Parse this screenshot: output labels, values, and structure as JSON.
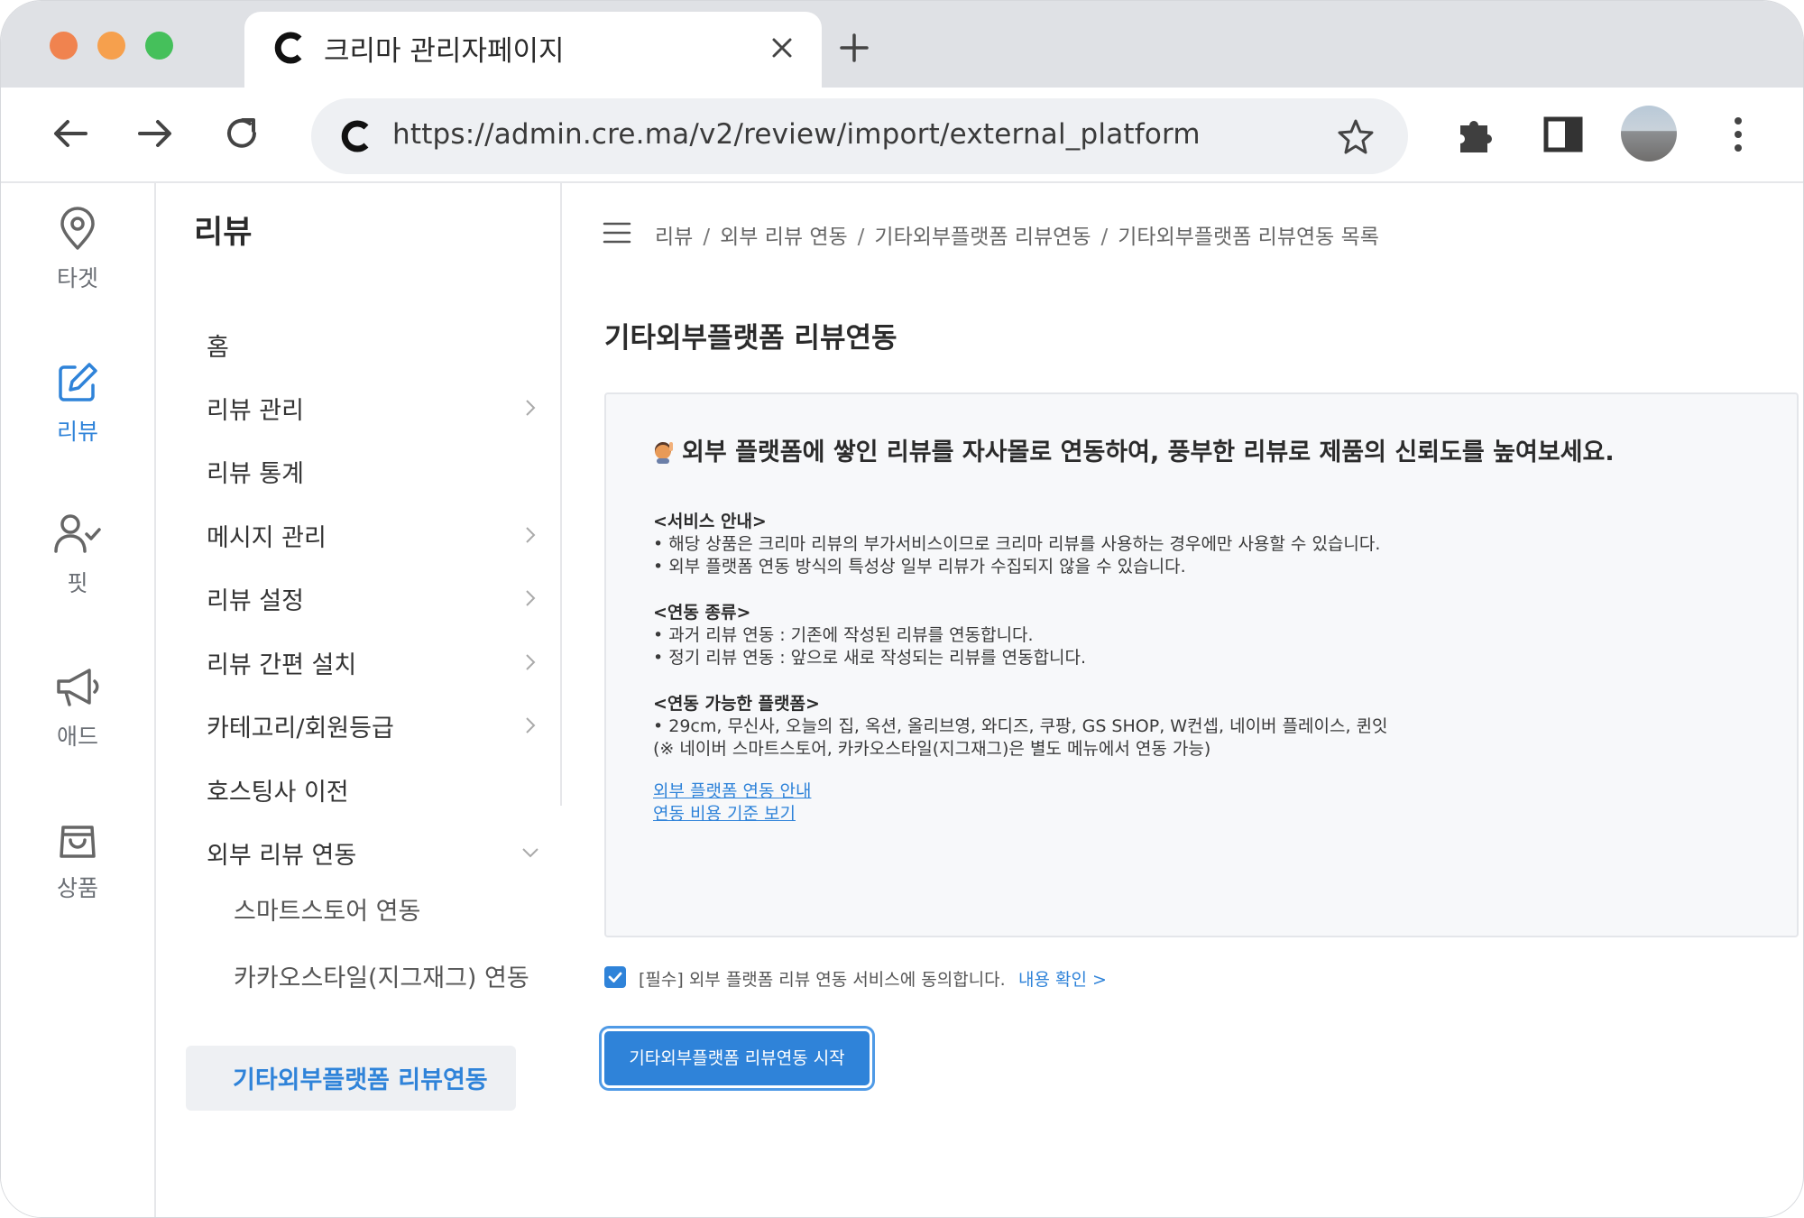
{
  "browser": {
    "tab_title": "크리마 관리자페이지",
    "url": "https://admin.cre.ma/v2/review/import/external_platform"
  },
  "rail": {
    "items": [
      {
        "label": "타겟",
        "icon": "map-pin-icon"
      },
      {
        "label": "리뷰",
        "icon": "edit-icon"
      },
      {
        "label": "핏",
        "icon": "user-check-icon"
      },
      {
        "label": "애드",
        "icon": "megaphone-icon"
      },
      {
        "label": "상품",
        "icon": "shopping-bag-icon"
      }
    ],
    "active": "리뷰"
  },
  "menu": {
    "title": "리뷰",
    "items": [
      {
        "label": "홈"
      },
      {
        "label": "리뷰 관리"
      },
      {
        "label": "리뷰 통계"
      },
      {
        "label": "메시지 관리"
      },
      {
        "label": "리뷰 설정"
      },
      {
        "label": "리뷰 간편 설치"
      },
      {
        "label": "카테고리/회원등급"
      },
      {
        "label": "호스팅사 이전"
      },
      {
        "label": "외부 리뷰 연동"
      }
    ],
    "subitems": [
      {
        "label": "스마트스토어 연동"
      },
      {
        "label": "카카오스타일(지그재그) 연동"
      },
      {
        "label": "기타외부플랫폼 리뷰연동"
      }
    ]
  },
  "breadcrumb": [
    "리뷰",
    "외부 리뷰 연동",
    "기타외부플랫폼 리뷰연동",
    "기타외부플랫폼 리뷰연동 목록"
  ],
  "page_title": "기타외부플랫폼 리뷰연동",
  "info": {
    "headline": "외부 플랫폼에 쌓인 리뷰를 자사몰로 연동하여, 풍부한 리뷰로 제품의 신뢰도를 높여보세요.",
    "service_title": "<서비스 안내>",
    "service_lines": [
      "• 해당 상품은 크리마 리뷰의 부가서비스이므로 크리마 리뷰를 사용하는 경우에만 사용할 수 있습니다.",
      "• 외부 플랫폼 연동 방식의 특성상 일부 리뷰가 수집되지 않을 수 있습니다."
    ],
    "types_title": "<연동 종류>",
    "types_lines": [
      "• 과거 리뷰 연동 : 기존에 작성된 리뷰를 연동합니다.",
      "• 정기 리뷰 연동 : 앞으로 새로 작성되는 리뷰를 연동합니다."
    ],
    "platforms_title": "<연동 가능한 플랫폼>",
    "platforms_lines": [
      "• 29cm, 무신사, 오늘의 집, 옥션, 올리브영, 와디즈, 쿠팡, GS SHOP, W컨셉, 네이버 플레이스, 퀸잇",
      "(※ 네이버 스마트스토어, 카카오스타일(지그재그)은 별도 메뉴에서 연동 가능)"
    ],
    "link_guide": "외부 플랫폼 연동 안내",
    "link_cost": "연동 비용 기준 보기"
  },
  "agreement": {
    "checked": true,
    "text": "[필수] 외부 플랫폼 리뷰 연동 서비스에 동의합니다.",
    "link": "내용 확인 >"
  },
  "start_button": "기타외부플랫폼 리뷰연동 시작",
  "colors": {
    "accent": "#2f83d9",
    "info_bg": "#f7f8fa",
    "tabstrip_bg": "#dfe1e5"
  }
}
